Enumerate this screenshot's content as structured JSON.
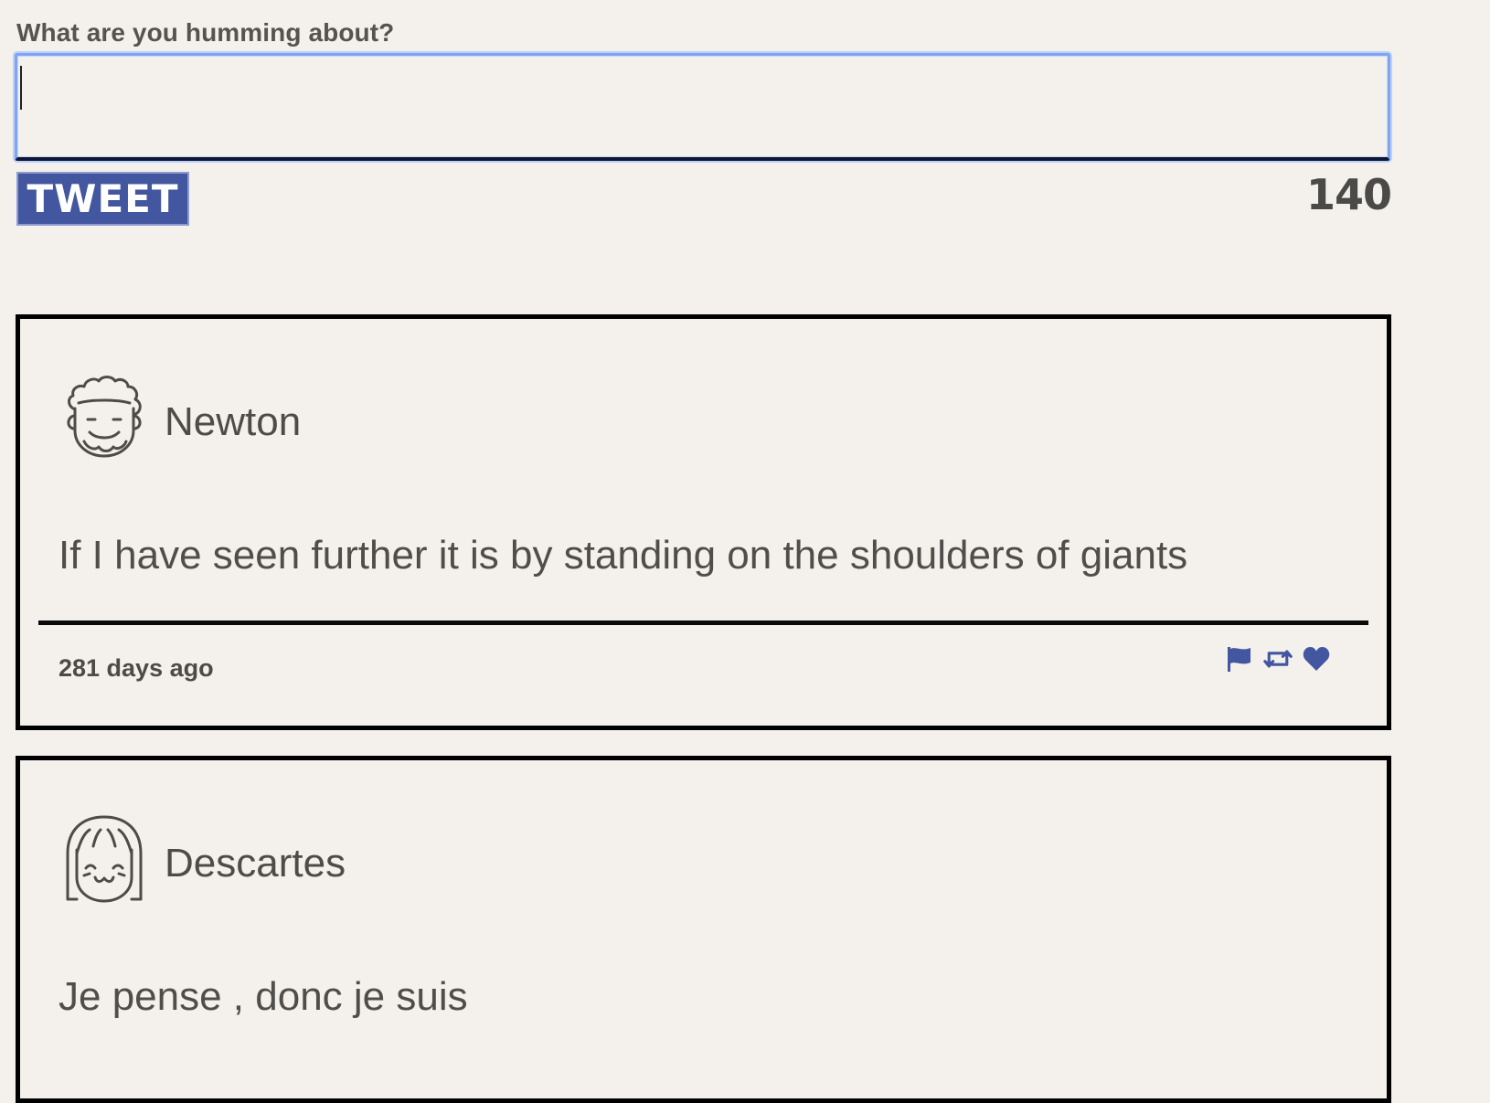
{
  "composer": {
    "label": "What are you humming about?",
    "value": "",
    "placeholder": "",
    "tweet_button_label": "TWEET",
    "char_count": "140"
  },
  "colors": {
    "background": "#f4f1ec",
    "accent": "#4356a0",
    "focus_border": "#7ea5f2",
    "text": "#555451"
  },
  "tweets": [
    {
      "author": "Newton",
      "avatar_icon": "curly-hair-man-avatar-icon",
      "text": "If I have seen further it is by standing on the shoulders of giants",
      "timestamp": "281 days ago",
      "actions": [
        "flag-icon",
        "retweet-icon",
        "heart-icon"
      ]
    },
    {
      "author": "Descartes",
      "avatar_icon": "bob-hair-avatar-icon",
      "text": "Je pense , donc je suis"
    }
  ]
}
